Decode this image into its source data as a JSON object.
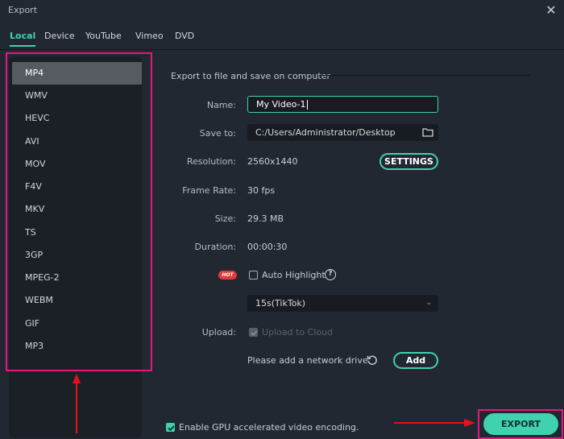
{
  "window": {
    "title": "Export",
    "close_icon": "close-icon"
  },
  "tabs": [
    {
      "label": "Local",
      "active": true
    },
    {
      "label": "Device",
      "active": false
    },
    {
      "label": "YouTube",
      "active": false
    },
    {
      "label": "Vimeo",
      "active": false
    },
    {
      "label": "DVD",
      "active": false
    }
  ],
  "formats": {
    "selected": "MP4",
    "items": [
      "MP4",
      "WMV",
      "HEVC",
      "AVI",
      "MOV",
      "F4V",
      "MKV",
      "TS",
      "3GP",
      "MPEG-2",
      "WEBM",
      "GIF",
      "MP3"
    ]
  },
  "settings": {
    "section_title": "Export to file and save on computer",
    "name_label": "Name:",
    "name_value": "My Video-1",
    "save_to_label": "Save to:",
    "save_to_value": "C:/Users/Administrator/Desktop",
    "resolution_label": "Resolution:",
    "resolution_value": "2560x1440",
    "settings_button": "SETTINGS",
    "frame_rate_label": "Frame Rate:",
    "frame_rate_value": "30 fps",
    "size_label": "Size:",
    "size_value": "29.3 MB",
    "duration_label": "Duration:",
    "duration_value": "00:00:30",
    "hot_badge": "HOT",
    "auto_highlight_label": "Auto Highlight",
    "auto_highlight_checked": false,
    "help_glyph": "?",
    "highlight_length_selected": "15s(TikTok)",
    "upload_label": "Upload:",
    "upload_to_cloud_label": "Upload to Cloud",
    "upload_to_cloud_checked": true,
    "upload_to_cloud_disabled": true,
    "network_drive_text": "Please add a network drive",
    "add_button": "Add"
  },
  "footer": {
    "gpu_label": "Enable GPU accelerated video encoding.",
    "gpu_checked": true,
    "export_button": "EXPORT"
  },
  "colors": {
    "accent": "#3fd1b0",
    "annotation_box": "#e6177e",
    "annotation_arrow": "#e8101c",
    "hot_badge": "#e03a3a",
    "background": "#222831"
  }
}
